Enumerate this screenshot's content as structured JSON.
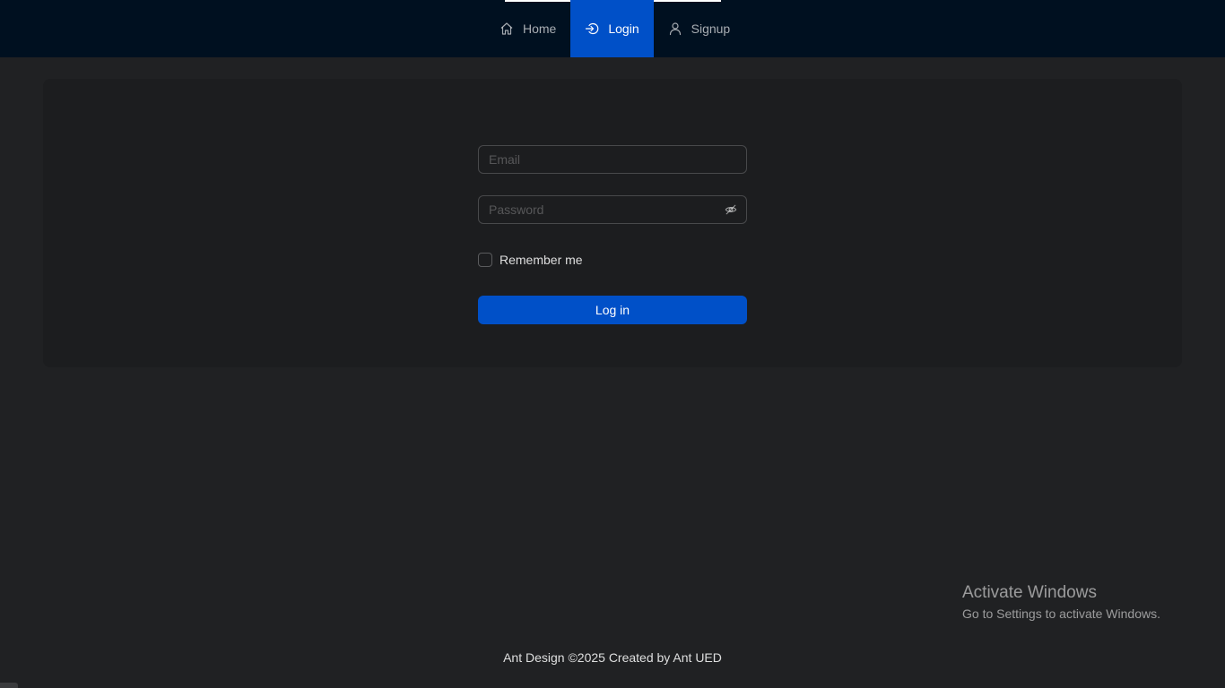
{
  "nav": {
    "items": [
      {
        "label": "Home",
        "icon": "home-icon"
      },
      {
        "label": "Login",
        "icon": "login-icon",
        "selected": true
      },
      {
        "label": "Signup",
        "icon": "user-icon"
      }
    ]
  },
  "form": {
    "email_placeholder": "Email",
    "email_value": "",
    "password_placeholder": "Password",
    "password_value": "",
    "remember_label": "Remember me",
    "remember_checked": false,
    "login_button": "Log in"
  },
  "watermark": {
    "title": "Activate Windows",
    "subtitle": "Go to Settings to activate Windows."
  },
  "footer": {
    "text": "Ant Design ©2025 Created by Ant UED"
  },
  "colors": {
    "header_bg": "#001020",
    "page_bg": "#202123",
    "card_bg": "#1c1d1f",
    "primary": "#0050c8"
  }
}
